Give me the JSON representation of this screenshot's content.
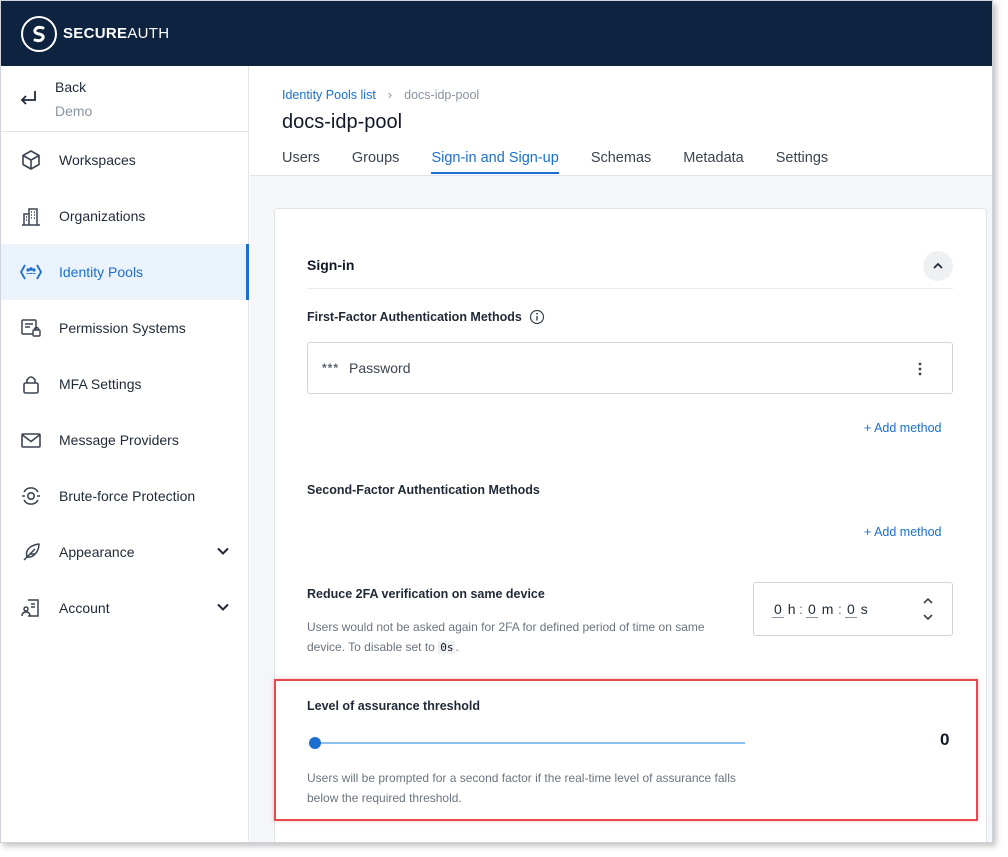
{
  "brand": {
    "name_bold": "SECURE",
    "name_rest": "AUTH"
  },
  "sidebar": {
    "back_label": "Back",
    "back_sub": "Demo",
    "items": [
      {
        "label": "Workspaces",
        "icon": "cube-icon"
      },
      {
        "label": "Organizations",
        "icon": "buildings-icon"
      },
      {
        "label": "Identity Pools",
        "icon": "identity-pools-icon",
        "active": true
      },
      {
        "label": "Permission Systems",
        "icon": "permission-icon"
      },
      {
        "label": "MFA Settings",
        "icon": "lock-icon"
      },
      {
        "label": "Message Providers",
        "icon": "envelope-icon"
      },
      {
        "label": "Brute-force Protection",
        "icon": "shield-target-icon"
      },
      {
        "label": "Appearance",
        "icon": "feather-icon",
        "expandable": true
      },
      {
        "label": "Account",
        "icon": "account-icon",
        "expandable": true
      }
    ]
  },
  "header": {
    "breadcrumb": {
      "link": "Identity Pools list",
      "current": "docs-idp-pool"
    },
    "title": "docs-idp-pool",
    "tabs": [
      "Users",
      "Groups",
      "Sign-in and Sign-up",
      "Schemas",
      "Metadata",
      "Settings"
    ],
    "active_tab": "Sign-in and Sign-up"
  },
  "signin": {
    "section_title": "Sign-in",
    "first_factor_label": "First-Factor Authentication Methods",
    "first_factor_method": {
      "stars": "***",
      "name": "Password"
    },
    "add_method_label": "+ Add method",
    "second_factor_label": "Second-Factor Authentication Methods",
    "reduce_2fa": {
      "label": "Reduce 2FA verification on same device",
      "desc_part1": "Users would not be asked again for 2FA for defined period of time on same device. To disable set to ",
      "desc_code": "0s",
      "desc_end": ".",
      "time": {
        "h": "0",
        "h_unit": "h",
        "m": "0",
        "m_unit": "m",
        "s": "0",
        "s_unit": "s"
      }
    },
    "loa": {
      "label": "Level of assurance threshold",
      "value": "0",
      "desc": "Users will be prompted for a second factor if the real-time level of assurance falls below the required threshold."
    }
  },
  "colors": {
    "topbar": "#0e2340",
    "accent": "#1a6fd1",
    "highlight": "#e5484d"
  }
}
